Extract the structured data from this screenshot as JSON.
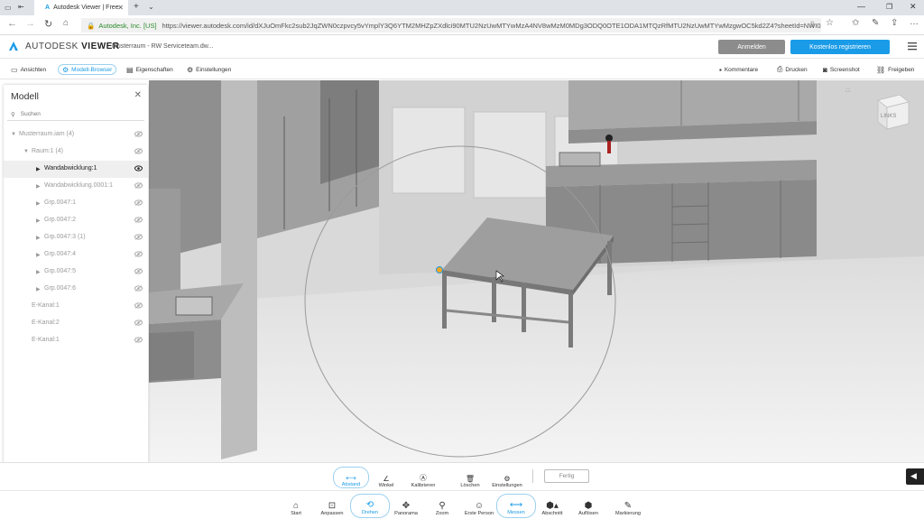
{
  "browser": {
    "tab_title": "Autodesk Viewer | Free",
    "site_identity": "Autodesk, Inc. [US]",
    "url": "https://viewer.autodesk.com/id/dXJuOmFkc2sub2JqZWN0czpvcy5vYmplY3Q6YTM2MHZpZXdlci90MTU2NzUwMTYwMzA4NV8wMzM0MDg3ODQ0OTE1ODA1MTQzRfMTU2NzUwMTYwMzgwOC5kd2Z4?sheetId=NWI0ZDg1YjUtZjQ0OS00"
  },
  "header": {
    "brand_prefix": "AUTODESK",
    "brand_product": "VIEWER",
    "document_title": "Musterraum - RW Serviceteam.dw...",
    "login_label": "Anmelden",
    "register_label": "Kostenlos registrieren"
  },
  "toolbar": {
    "views": "Ansichten",
    "model_browser": "Modell-Browser",
    "properties": "Eigenschaften",
    "settings": "Einstellungen",
    "comments": "Kommentare",
    "print": "Drucken",
    "screenshot": "Screenshot",
    "share": "Freigeben"
  },
  "panel": {
    "title": "Modell",
    "search_placeholder": "Suchen",
    "items": [
      {
        "label": "Musterraum.iam (4)",
        "caret": "▼"
      },
      {
        "label": "Raum:1 (4)",
        "caret": "▼"
      },
      {
        "label": "Wandabwicklung:1",
        "caret": "▶"
      },
      {
        "label": "Wandabwicklung.0001:1",
        "caret": "▶"
      },
      {
        "label": "Grp.0047:1",
        "caret": "▶"
      },
      {
        "label": "Grp.0047:2",
        "caret": "▶"
      },
      {
        "label": "Grp.0047:3 (1)",
        "caret": "▶"
      },
      {
        "label": "Grp.0047:4",
        "caret": "▶"
      },
      {
        "label": "Grp.0047:5",
        "caret": "▶"
      },
      {
        "label": "Grp.0047:6",
        "caret": "▶"
      },
      {
        "label": "E-Kanal:1",
        "caret": ""
      },
      {
        "label": "E-Kanal:2",
        "caret": ""
      },
      {
        "label": "E-Kanal:1",
        "caret": ""
      }
    ],
    "selected_index": 2
  },
  "viewcube": {
    "face_label": "LINKS"
  },
  "measure": {
    "distance": "Abstand",
    "angle": "Winkel",
    "calibrate": "Kalibrieren",
    "delete": "Löschen",
    "settings": "Einstellungen",
    "done": "Fertig"
  },
  "nav": {
    "home": "Start",
    "fit": "Anpassen",
    "orbit": "Drehen",
    "pan": "Panorama",
    "zoom": "Zoom",
    "first_person": "Erste Person",
    "measure": "Messen",
    "section": "Abschnitt",
    "explode": "Auflösen",
    "markup": "Markierung"
  },
  "colors": {
    "accent": "#1a9be8",
    "login_button": "#8c8c8c"
  }
}
